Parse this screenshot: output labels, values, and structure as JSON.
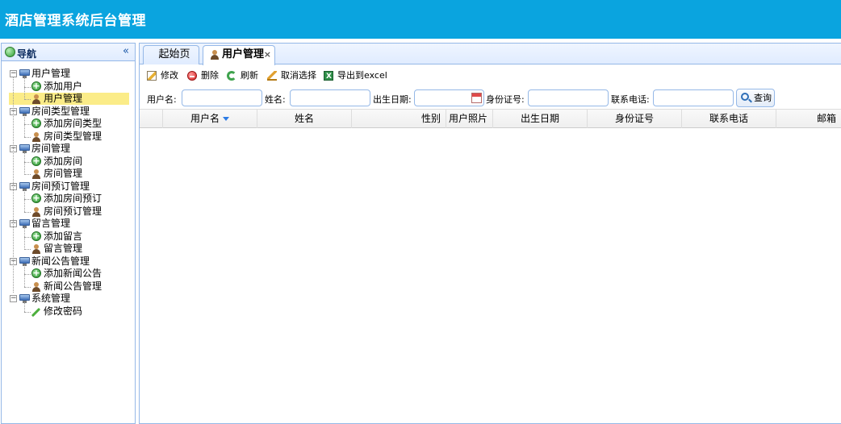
{
  "header": {
    "title": "酒店管理系统后台管理"
  },
  "nav": {
    "title": "导航",
    "collapse_glyph": "«",
    "groups": [
      {
        "label": "用户管理",
        "children": [
          {
            "label": "添加用户",
            "icon": "add-icon"
          },
          {
            "label": "用户管理",
            "icon": "user-icon",
            "selected": true
          }
        ]
      },
      {
        "label": "房间类型管理",
        "children": [
          {
            "label": "添加房间类型",
            "icon": "add-icon"
          },
          {
            "label": "房间类型管理",
            "icon": "user-icon"
          }
        ]
      },
      {
        "label": "房间管理",
        "children": [
          {
            "label": "添加房间",
            "icon": "add-icon"
          },
          {
            "label": "房间管理",
            "icon": "user-icon"
          }
        ]
      },
      {
        "label": "房间预订管理",
        "children": [
          {
            "label": "添加房间预订",
            "icon": "add-icon"
          },
          {
            "label": "房间预订管理",
            "icon": "user-icon"
          }
        ]
      },
      {
        "label": "留言管理",
        "children": [
          {
            "label": "添加留言",
            "icon": "add-icon"
          },
          {
            "label": "留言管理",
            "icon": "user-icon"
          }
        ]
      },
      {
        "label": "新闻公告管理",
        "children": [
          {
            "label": "添加新闻公告",
            "icon": "add-icon"
          },
          {
            "label": "新闻公告管理",
            "icon": "user-icon"
          }
        ]
      },
      {
        "label": "系统管理",
        "children": [
          {
            "label": "修改密码",
            "icon": "pencil-icon"
          }
        ]
      }
    ]
  },
  "tabs": {
    "home_label": "起始页",
    "active_label": "用户管理",
    "close_glyph": "×"
  },
  "toolbar": {
    "edit_label": "修改",
    "delete_label": "删除",
    "refresh_label": "刷新",
    "cancel_select_label": "取消选择",
    "export_label": "导出到excel"
  },
  "search": {
    "username_label": "用户名:",
    "username_value": "",
    "name_label": "姓名:",
    "name_value": "",
    "birthday_label": "出生日期:",
    "birthday_value": "",
    "idcard_label": "身份证号:",
    "idcard_value": "",
    "phone_label": "联系电话:",
    "phone_value": "",
    "query_label": "查询"
  },
  "grid": {
    "columns": [
      "用户名",
      "姓名",
      "性别",
      "用户照片",
      "出生日期",
      "身份证号",
      "联系电话",
      "邮箱"
    ],
    "sort_column": "用户名",
    "rows": []
  }
}
